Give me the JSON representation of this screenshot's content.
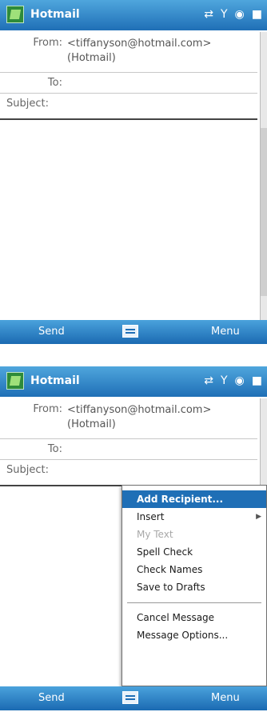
{
  "title": "Hotmail",
  "compose": {
    "from_label": "From:",
    "from_value": "<tiffanyson@hotmail.com> (Hotmail)",
    "to_label": "To:",
    "to_value": "",
    "subject_label": "Subject:",
    "subject_value": ""
  },
  "softkeys": {
    "left": "Send",
    "right": "Menu"
  },
  "menu": {
    "items": [
      {
        "label": "Add Recipient...",
        "state": "selected"
      },
      {
        "label": "Insert",
        "state": "submenu"
      },
      {
        "label": "My Text",
        "state": "disabled"
      },
      {
        "label": "Spell Check",
        "state": "normal"
      },
      {
        "label": "Check Names",
        "state": "normal"
      },
      {
        "label": "Save to Drafts",
        "state": "normal"
      },
      {
        "label": "Cancel Message",
        "state": "normal"
      },
      {
        "label": "Message Options...",
        "state": "normal"
      }
    ]
  },
  "colors": {
    "accent": "#1f6fb6",
    "titlebar": "#3f95d3"
  },
  "icons": [
    "app-logo",
    "connectivity-icon",
    "signal-icon",
    "volume-icon",
    "ok-icon",
    "keyboard-icon"
  ]
}
